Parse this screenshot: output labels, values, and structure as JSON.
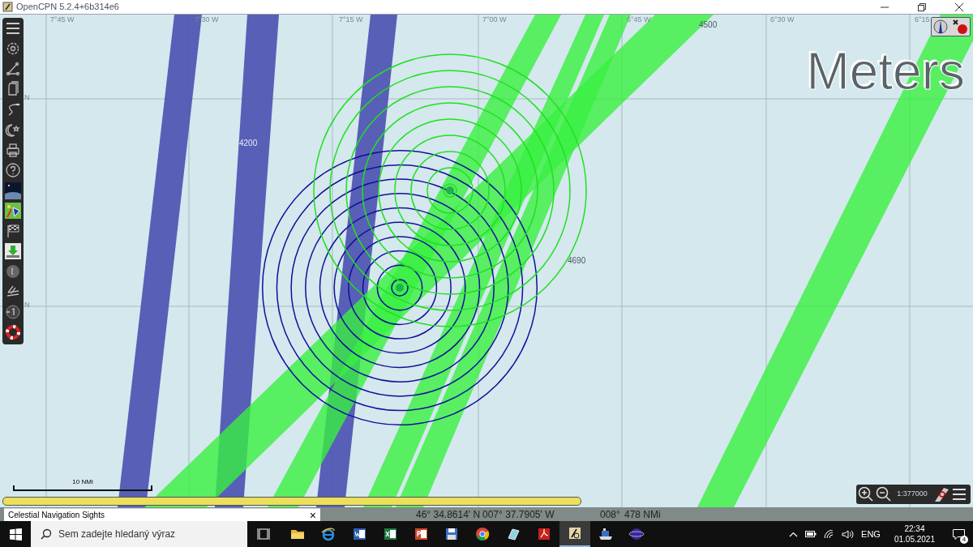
{
  "window": {
    "title": "OpenCPN 5.2.4+6b314e6"
  },
  "toolbar": {
    "tools": [
      {
        "kind": "menu"
      },
      {
        "kind": "settings"
      },
      {
        "kind": "route"
      },
      {
        "kind": "pages"
      },
      {
        "kind": "track"
      },
      {
        "kind": "night"
      },
      {
        "kind": "print"
      },
      {
        "kind": "help"
      },
      {
        "kind": "sky"
      },
      {
        "kind": "celestial"
      },
      {
        "kind": "flag"
      },
      {
        "kind": "download"
      },
      {
        "kind": "globe"
      },
      {
        "kind": "chart"
      },
      {
        "kind": "clock"
      },
      {
        "kind": "lifebuoy"
      }
    ]
  },
  "chart": {
    "grid_labels": [
      "7°45 W",
      "7°30 W",
      "7°15 W",
      "7°00 W",
      "6°45 W",
      "6°30 W",
      "6°15",
      "N",
      "N"
    ],
    "depth_labels": [
      "4500",
      "4200",
      "4690"
    ],
    "units_label": "Meters",
    "scale_bar": "10 NMi",
    "chart_bar": {
      "keys": [
        {
          "selected": true
        }
      ]
    }
  },
  "sights_window": {
    "title": "Celestial Navigation Sights",
    "close": "×"
  },
  "status_bar": {
    "latitude": "46° 34.8614' N",
    "longitude": "007° 37.7905' W",
    "bearing": "008°",
    "distance": "478 NMi"
  },
  "zoom_panel": {
    "scale": "1:377000"
  },
  "taskbar": {
    "search_placeholder": "Sem zadejte hledaný výraz",
    "apps": [
      {
        "kind": "taskview",
        "selected": false
      },
      {
        "kind": "folder",
        "selected": false
      },
      {
        "kind": "ie",
        "selected": false
      },
      {
        "kind": "word",
        "selected": false
      },
      {
        "kind": "excel",
        "selected": false
      },
      {
        "kind": "powerpoint",
        "selected": false
      },
      {
        "kind": "disk",
        "selected": false
      },
      {
        "kind": "chrome",
        "selected": false
      },
      {
        "kind": "book",
        "selected": false
      },
      {
        "kind": "pdf",
        "selected": false
      },
      {
        "kind": "opencpn",
        "selected": true
      },
      {
        "kind": "ship",
        "selected": false
      },
      {
        "kind": "planet",
        "selected": false
      }
    ],
    "language": "ENG",
    "time": "22:34",
    "date": "01.05.2021",
    "notifications": "4"
  }
}
